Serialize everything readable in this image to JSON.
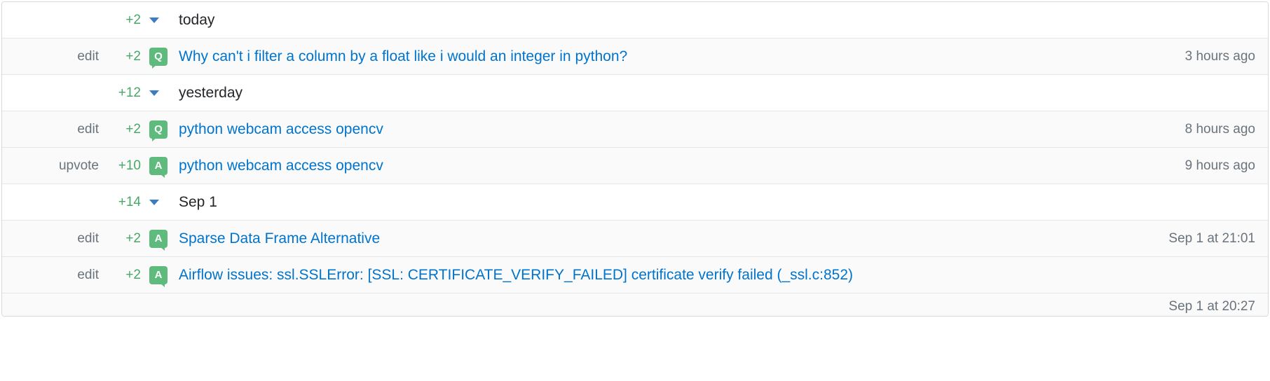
{
  "groups": [
    {
      "rep": "+2",
      "label": "today",
      "items": [
        {
          "action": "edit",
          "rep": "+2",
          "badge": "Q",
          "title": "Why can't i filter a column by a float like i would an integer in python?",
          "time": "3 hours ago",
          "time_below": false
        }
      ]
    },
    {
      "rep": "+12",
      "label": "yesterday",
      "items": [
        {
          "action": "edit",
          "rep": "+2",
          "badge": "Q",
          "title": "python webcam access opencv",
          "time": "8 hours ago",
          "time_below": false
        },
        {
          "action": "upvote",
          "rep": "+10",
          "badge": "A",
          "title": "python webcam access opencv",
          "time": "9 hours ago",
          "time_below": false
        }
      ]
    },
    {
      "rep": "+14",
      "label": "Sep 1",
      "items": [
        {
          "action": "edit",
          "rep": "+2",
          "badge": "A",
          "title": "Sparse Data Frame Alternative",
          "time": "Sep 1 at 21:01",
          "time_below": false
        },
        {
          "action": "edit",
          "rep": "+2",
          "badge": "A",
          "title": "Airflow issues: ssl.SSLError: [SSL: CERTIFICATE_VERIFY_FAILED] certificate verify failed (_ssl.c:852)",
          "time": "Sep 1 at 20:27",
          "time_below": true
        }
      ]
    }
  ]
}
